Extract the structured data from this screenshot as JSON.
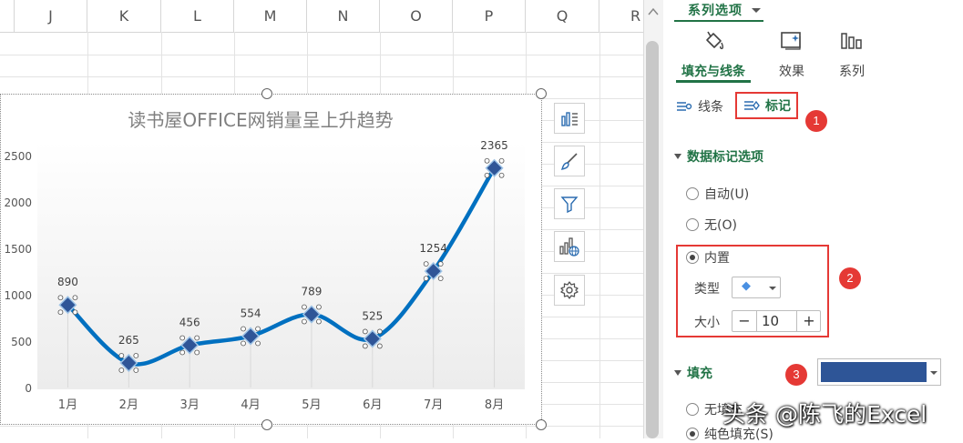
{
  "sheet": {
    "columns": [
      "J",
      "K",
      "L",
      "M",
      "N",
      "O",
      "P",
      "Q",
      "R"
    ]
  },
  "chart": {
    "tools": [
      "chart-elements-icon",
      "chart-style-icon",
      "chart-filter-icon",
      "chart-insert-icon",
      "chart-settings-icon"
    ]
  },
  "chart_data": {
    "type": "line",
    "title": "读书屋OFFICE网销量呈上升趋势",
    "categories": [
      "1月",
      "2月",
      "3月",
      "4月",
      "5月",
      "6月",
      "7月",
      "8月"
    ],
    "values": [
      890,
      265,
      456,
      554,
      789,
      525,
      1254,
      2365
    ],
    "data_labels": [
      "890",
      "265",
      "456",
      "554",
      "789",
      "525",
      "1254",
      "2365"
    ],
    "ylim": [
      0,
      2500
    ],
    "yticks": [
      "0",
      "500",
      "1000",
      "1500",
      "2000",
      "2500"
    ],
    "smooth": true,
    "grid": false,
    "marker": "diamond",
    "line_color": "#0070c0",
    "marker_color": "#2f5597",
    "xlabel": "",
    "ylabel": ""
  },
  "pane": {
    "series_options_label": "系列选项",
    "tabs": [
      {
        "label": "填充与线条",
        "icon": "paint-bucket-icon",
        "active": true
      },
      {
        "label": "效果",
        "icon": "effects-icon",
        "active": false
      },
      {
        "label": "系列",
        "icon": "series-bars-icon",
        "active": false
      }
    ],
    "subtabs": {
      "line": "线条",
      "marker": "标记"
    },
    "marker_options": {
      "heading": "数据标记选项",
      "auto": "自动(U)",
      "none": "无(O)",
      "builtin": "内置",
      "type_label": "类型",
      "type_value": "◆",
      "size_label": "大小",
      "size_value": "10",
      "minus": "−",
      "plus": "+"
    },
    "fill": {
      "heading": "填充",
      "color": "#2e5597",
      "no_fill": "无填充",
      "solid_fill": "纯色填充(S)"
    },
    "badges": [
      "1",
      "2",
      "3"
    ],
    "accent_color": "#217346"
  },
  "watermark": "头条 @陈飞的Excel"
}
